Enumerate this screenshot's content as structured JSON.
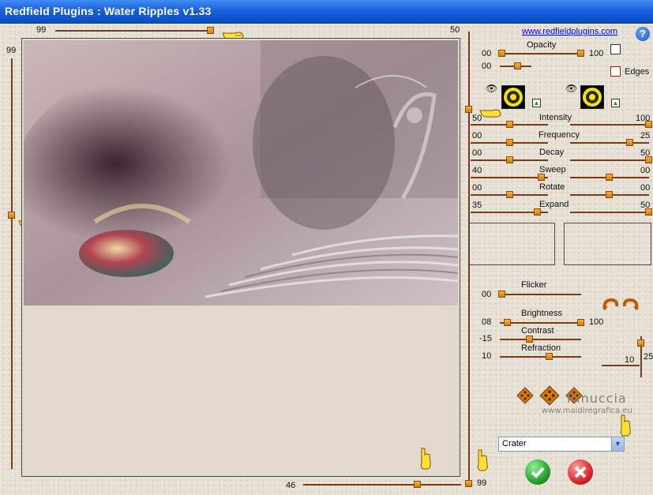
{
  "window": {
    "title": "Redfield Plugins : Water Ripples v1.33"
  },
  "top_slider": {
    "left_value": "99",
    "right_value": "50"
  },
  "left_slider": {
    "value": "99"
  },
  "bottom_slider": {
    "value": "46",
    "right_value": "99"
  },
  "link": {
    "text": "www.redfieldplugins.com"
  },
  "help": {
    "label": "?"
  },
  "opacity": {
    "label": "Opacity",
    "min": "00",
    "max": "100"
  },
  "second_row": {
    "value": "00"
  },
  "edges": {
    "label": "Edges"
  },
  "params": [
    {
      "label": "Intensity",
      "left": "50",
      "right": "100"
    },
    {
      "label": "Frequency",
      "left": "00",
      "right": "25"
    },
    {
      "label": "Decay",
      "left": "00",
      "right": "50"
    },
    {
      "label": "Sweep",
      "left": "40",
      "right": "00"
    },
    {
      "label": "Rotate",
      "left": "00",
      "right": "00"
    },
    {
      "label": "Expand",
      "left": "35",
      "right": "50"
    }
  ],
  "flicker": {
    "label": "Flicker",
    "value": "00"
  },
  "brightness": {
    "label": "Brightness",
    "value": "08",
    "max": "100"
  },
  "contrast": {
    "label": "Contrast",
    "value": "-15"
  },
  "refraction": {
    "label": "Refraction",
    "value": "10"
  },
  "side_slider": {
    "value": "10",
    "max": "25"
  },
  "preset": {
    "selected": "Crater"
  },
  "watermark": {
    "line1": "Rinuccia",
    "line2": "www.maidiregrafica.eu"
  },
  "icons": {
    "hand": "pointing-hand-icon",
    "eye": "eye-icon",
    "ok": "check-icon",
    "cancel": "x-icon",
    "dice": "dice-icon",
    "undo": "undo-icon",
    "redo": "redo-icon"
  },
  "colors": {
    "title": "#0a49c9",
    "knob": "#e08a0e",
    "track": "#7a3b18"
  }
}
